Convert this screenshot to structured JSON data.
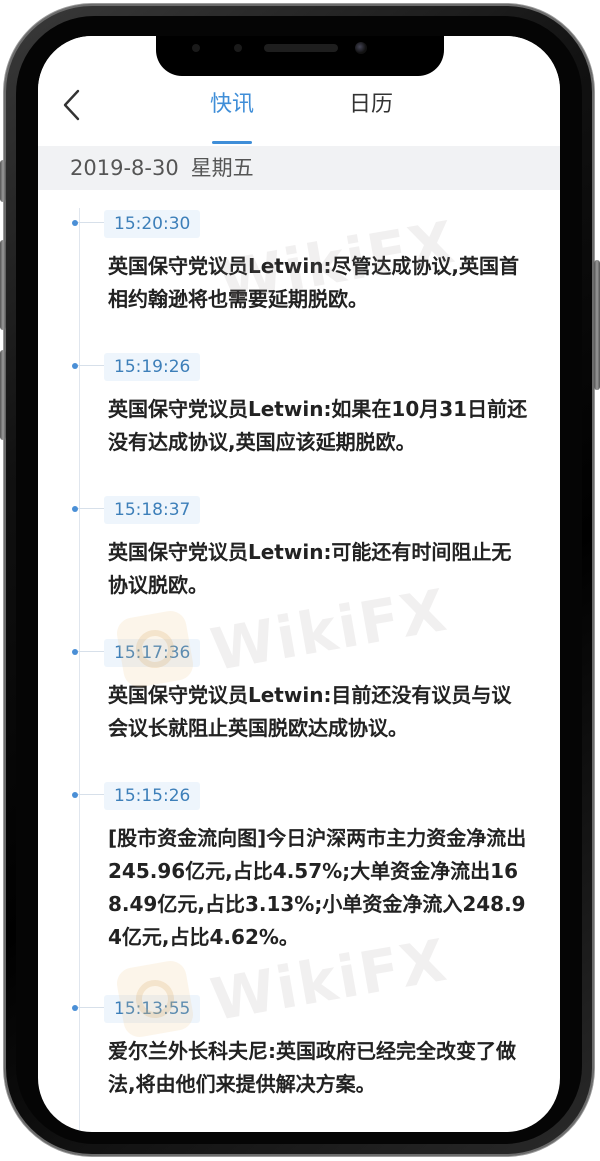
{
  "nav": {
    "back_icon": "chevron-left-icon",
    "tabs": [
      {
        "label": "快讯",
        "active": true
      },
      {
        "label": "日历",
        "active": false
      }
    ],
    "accent_color": "#3f8ed8"
  },
  "date_bar": {
    "date": "2019-8-30",
    "weekday": "星期五"
  },
  "watermark": {
    "brand": "WikiFX"
  },
  "feed": [
    {
      "time": "15:20:30",
      "text": "英国保守党议员Letwin:尽管达成协议,英国首相约翰逊将也需要延期脱欧。"
    },
    {
      "time": "15:19:26",
      "text": "英国保守党议员Letwin:如果在10月31日前还没有达成协议,英国应该延期脱欧。"
    },
    {
      "time": "15:18:37",
      "text": "英国保守党议员Letwin:可能还有时间阻止无协议脱欧。"
    },
    {
      "time": "15:17:36",
      "text": "英国保守党议员Letwin:目前还没有议员与议会议长就阻止英国脱欧达成协议。"
    },
    {
      "time": "15:15:26",
      "text": "[股市资金流向图]今日沪深两市主力资金净流出245.96亿元,占比4.57%;大单资金净流出168.49亿元,占比3.13%;小单资金净流入248.94亿元,占比4.62%。"
    },
    {
      "time": "15:13:55",
      "text": "爱尔兰外长科夫尼:英国政府已经完全改变了做法,将由他们来提供解决方案。"
    }
  ]
}
